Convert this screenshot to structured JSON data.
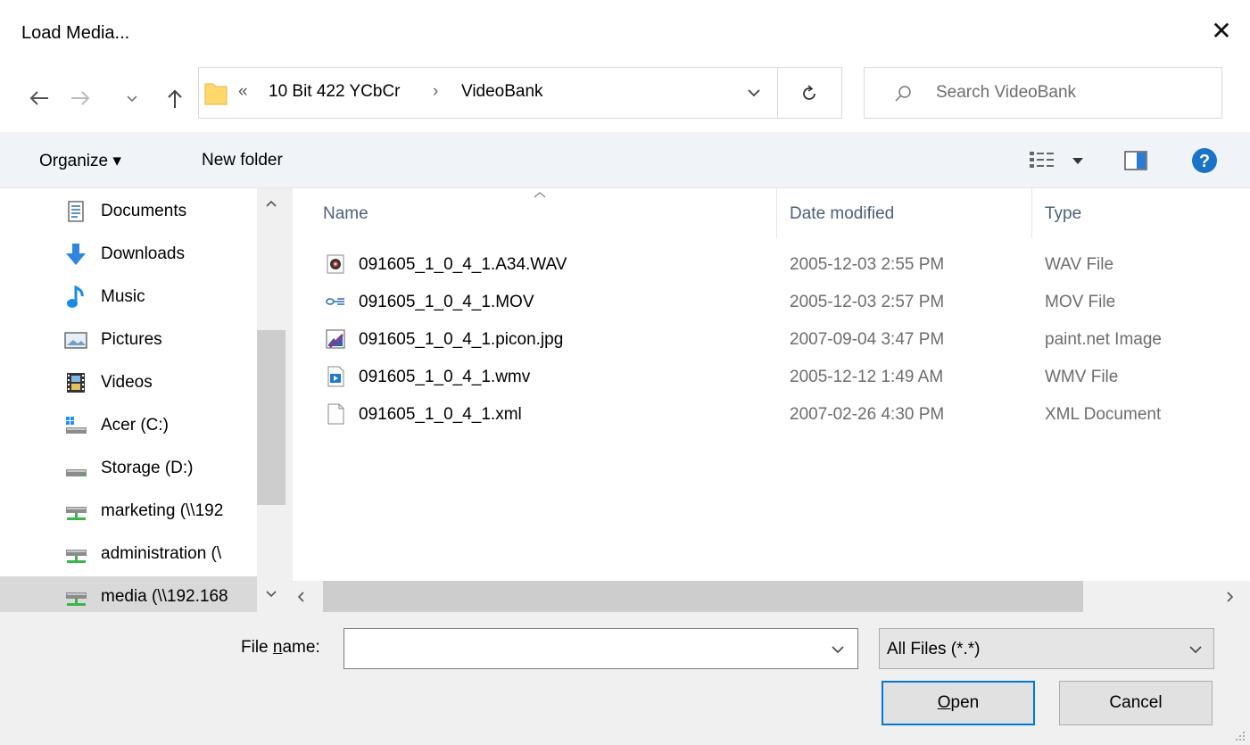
{
  "window": {
    "title": "Load Media...",
    "close_icon": "close-icon"
  },
  "nav": {
    "back_icon": "back-arrow-icon",
    "forward_icon": "forward-arrow-icon",
    "recent_icon": "chevron-down-icon",
    "up_icon": "up-arrow-icon",
    "breadcrumb": {
      "overflow": "«",
      "segments": [
        "10 Bit 422 YCbCr",
        "VideoBank"
      ],
      "separator": "›"
    },
    "search_placeholder": "Search VideoBank"
  },
  "toolbar": {
    "organize_label": "Organize ▾",
    "new_folder_label": "New folder"
  },
  "sidebar": {
    "items": [
      {
        "label": "Documents",
        "icon": "documents-icon"
      },
      {
        "label": "Downloads",
        "icon": "downloads-icon"
      },
      {
        "label": "Music",
        "icon": "music-icon"
      },
      {
        "label": "Pictures",
        "icon": "pictures-icon"
      },
      {
        "label": "Videos",
        "icon": "videos-icon"
      },
      {
        "label": "Acer (C:)",
        "icon": "system-drive-icon"
      },
      {
        "label": "Storage (D:)",
        "icon": "drive-icon"
      },
      {
        "label": "marketing (\\\\192",
        "icon": "network-drive-icon"
      },
      {
        "label": "administration (\\",
        "icon": "network-drive-icon"
      },
      {
        "label": "media (\\\\192.168",
        "icon": "network-drive-icon"
      }
    ]
  },
  "columns": {
    "name": "Name",
    "date": "Date modified",
    "type": "Type"
  },
  "files": [
    {
      "name": "091605_1_0_4_1.A34.WAV",
      "date": "2005-12-03 2:55 PM",
      "type": "WAV File",
      "icon": "audio-file-icon"
    },
    {
      "name": "091605_1_0_4_1.MOV",
      "date": "2005-12-03 2:57 PM",
      "type": "MOV File",
      "icon": "quicktime-file-icon"
    },
    {
      "name": "091605_1_0_4_1.picon.jpg",
      "date": "2007-09-04 3:47 PM",
      "type": "paint.net Image",
      "icon": "image-file-icon"
    },
    {
      "name": "091605_1_0_4_1.wmv",
      "date": "2005-12-12 1:49 AM",
      "type": "WMV File",
      "icon": "video-file-icon"
    },
    {
      "name": "091605_1_0_4_1.xml",
      "date": "2007-02-26 4:30 PM",
      "type": "XML Document",
      "icon": "text-file-icon"
    }
  ],
  "bottom": {
    "filename_label_pre": "File ",
    "filename_label_accel": "n",
    "filename_label_post": "ame:",
    "filename_value": "",
    "filter_value": "All Files (*.*)",
    "open_accel": "O",
    "open_rest": "pen",
    "cancel_label": "Cancel"
  },
  "colors": {
    "accent": "#0078d7",
    "help": "#1a73c9",
    "header_text": "#4c607a"
  }
}
